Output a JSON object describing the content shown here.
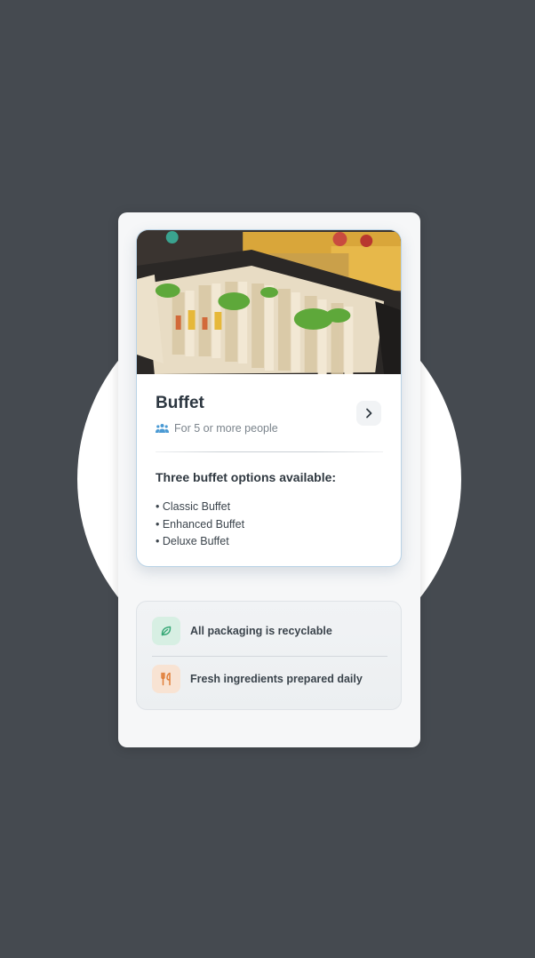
{
  "card": {
    "image_alt": "Platters of sandwiches",
    "title": "Buffet",
    "people_label": "For 5 or more people",
    "options_heading": "Three buffet options available:",
    "options": [
      "• Classic Buffet",
      "• Enhanced Buffet",
      "• Deluxe Buffet"
    ]
  },
  "info": {
    "items": [
      {
        "icon": "leaf-icon",
        "label": "All packaging is recyclable",
        "color": "#3aa978"
      },
      {
        "icon": "cutlery-icon",
        "label": "Fresh ingredients prepared daily",
        "color": "#e07f3a"
      }
    ]
  },
  "colors": {
    "page_bg": "#454a50",
    "card_border": "#b9d3e6",
    "people_icon": "#4a9ad4"
  }
}
